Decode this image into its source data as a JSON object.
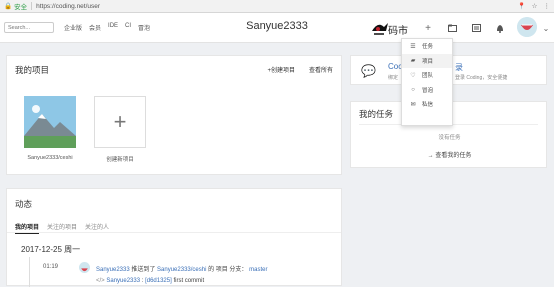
{
  "browser": {
    "security_label": "安全",
    "url": "https://coding.net/user"
  },
  "topbar": {
    "search_placeholder": "Search...",
    "nav": [
      "企业版",
      "会员",
      "IDE",
      "CI",
      "冒泡"
    ],
    "title": "Sanyue2333",
    "logo_text": "码市"
  },
  "dropdown": {
    "items": [
      {
        "label": "任务",
        "icon": "list-icon"
      },
      {
        "label": "项目",
        "icon": "folder-icon"
      },
      {
        "label": "团队",
        "icon": "team-icon"
      },
      {
        "label": "冒泡",
        "icon": "bubble-icon"
      },
      {
        "label": "私信",
        "icon": "mail-icon"
      }
    ]
  },
  "my_projects": {
    "title": "我的项目",
    "create_link": "+创建项目",
    "view_all": "查看所有",
    "project_name": "Sanyue2333/ceshi",
    "new_project_label": "创建新项目"
  },
  "notice": {
    "title_left": "Coc",
    "title_right": "录",
    "sub_left": "绑定",
    "sub_right": "登录 Coding，安全便捷"
  },
  "tasks": {
    "title": "我的任务",
    "empty": "没有任务",
    "view_link": "→ 查看我的任务"
  },
  "activity": {
    "title": "动态",
    "tabs": [
      "我的项目",
      "关注的项目",
      "关注的人"
    ],
    "date": "2017-12-25 周一",
    "time": "01:19",
    "user": "Sanyue2333",
    "action": " 推送到了 ",
    "repo": "Sanyue2333/ceshi",
    "project_word": " 的 项目 分支：",
    "branch": "master",
    "commit_user": "Sanyue2333",
    "commit_hash": "[d6d1325]",
    "commit_msg": "first commit"
  },
  "colors": {
    "accent_link": "#3a6fb7",
    "secure_green": "#2e9e47",
    "brand_red": "#c0202c"
  }
}
